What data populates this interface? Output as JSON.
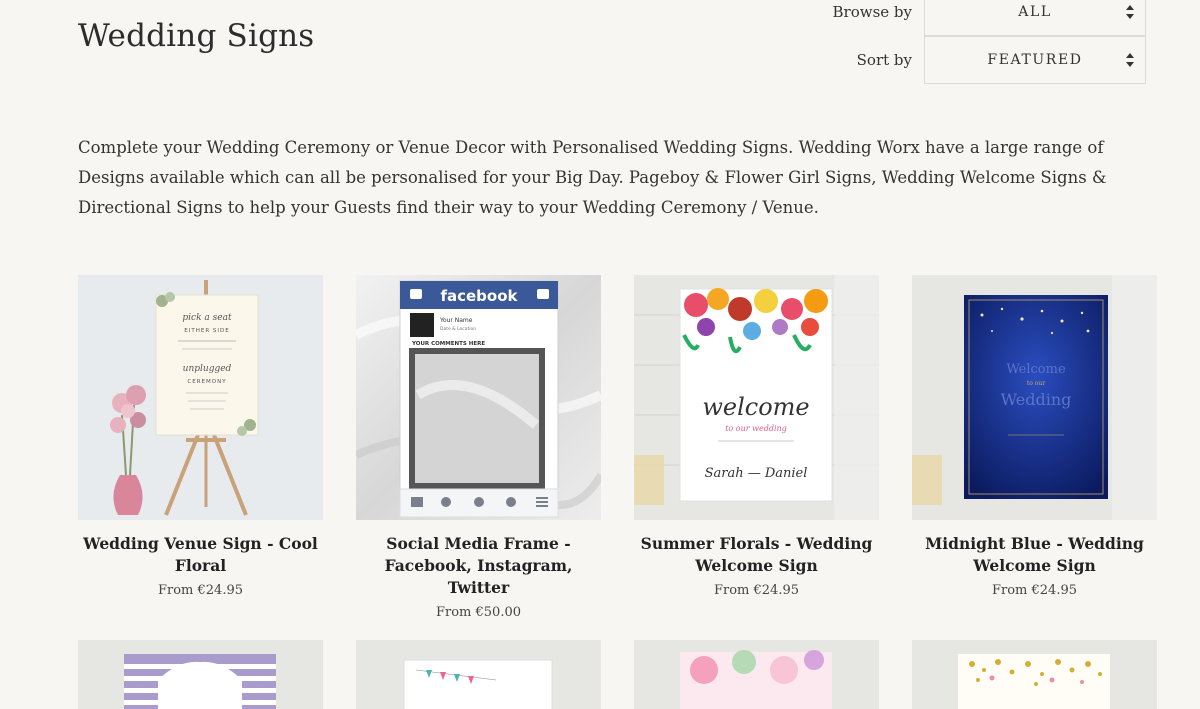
{
  "page": {
    "title": "Wedding Signs",
    "description": "Complete your Wedding Ceremony or Venue Decor with Personalised Wedding Signs. Wedding Worx have a large range of Designs available which can all be personalised for your Big Day. Pageboy & Flower Girl Signs, Wedding Welcome Signs & Directional Signs to help your Guests find their way to your Wedding Ceremony / Venue."
  },
  "filters": {
    "browse": {
      "label": "Browse by",
      "value": "ALL"
    },
    "sort": {
      "label": "Sort by",
      "value": "FEATURED"
    }
  },
  "products": [
    {
      "title": "Wedding Venue Sign - Cool Floral",
      "price": "From €24.95"
    },
    {
      "title": "Social Media Frame - Facebook, Instagram, Twitter",
      "price": "From €50.00"
    },
    {
      "title": "Summer Florals - Wedding Welcome Sign",
      "price": "From €24.95"
    },
    {
      "title": "Midnight Blue - Wedding Welcome Sign",
      "price": "From €24.95"
    }
  ],
  "thumb_text": {
    "fb_brand": "facebook",
    "fb_name": "Your Name",
    "fb_date": "Date & Location",
    "fb_comments": "YOUR COMMENTS HERE",
    "sign1_l1": "pick a seat",
    "sign1_l2": "EITHER SIDE",
    "sign1_l3": "unplugged",
    "sign1_l4": "CEREMONY",
    "sign3_l1": "welcome",
    "sign3_l2": "to our wedding",
    "sign3_l3": "Sarah — Daniel",
    "sign4_l1": "Welcome",
    "sign4_l2": "to our",
    "sign4_l3": "Wedding"
  },
  "colors": {
    "background": "#f7f6f3",
    "facebook_blue": "#3b5998",
    "midnight_blue": "#12237a"
  }
}
